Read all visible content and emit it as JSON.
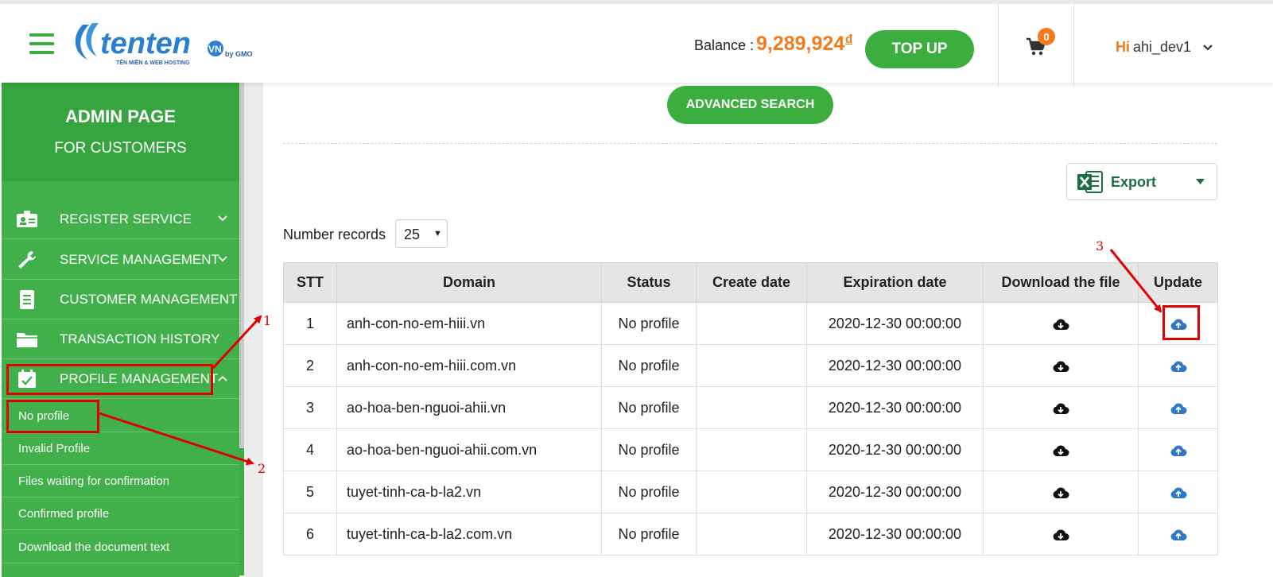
{
  "header": {
    "logo_text": "tenten",
    "logo_vn": "VN",
    "logo_gmo": "by GMO",
    "logo_tagline": "TÊN MIỀN & WEB HOSTING",
    "balance_label": "Balance :",
    "balance_amount": "9,289,924",
    "balance_currency": "đ",
    "topup_label": "TOP UP",
    "cart_count": "0",
    "greeting": "Hi",
    "username": "ahi_dev1"
  },
  "sidebar": {
    "title": "ADMIN PAGE",
    "subtitle": "FOR CUSTOMERS",
    "items": [
      {
        "label": "REGISTER SERVICE",
        "icon": "id-card-icon"
      },
      {
        "label": "SERVICE MANAGEMENT",
        "icon": "wrench-icon"
      },
      {
        "label": "CUSTOMER MANAGEMENT",
        "icon": "document-icon"
      },
      {
        "label": "TRANSACTION HISTORY",
        "icon": "folder-icon"
      },
      {
        "label": "PROFILE MANAGEMENT",
        "icon": "calendar-check-icon"
      }
    ],
    "sub_items": [
      {
        "label": "No profile"
      },
      {
        "label": "Invalid Profile"
      },
      {
        "label": "Files waiting for confirmation"
      },
      {
        "label": "Confirmed profile"
      },
      {
        "label": "Download the document text"
      }
    ]
  },
  "main": {
    "advanced_search_label": "ADVANCED SEARCH",
    "export_label": "Export",
    "number_records_label": "Number records",
    "number_records_value": "25",
    "columns": [
      "STT",
      "Domain",
      "Status",
      "Create date",
      "Expiration date",
      "Download the file",
      "Update"
    ],
    "rows": [
      {
        "stt": "1",
        "domain": "anh-con-no-em-hiii.vn",
        "status": "No profile",
        "create_date": "",
        "expiration_date": "2020-12-30 00:00:00"
      },
      {
        "stt": "2",
        "domain": "anh-con-no-em-hiii.com.vn",
        "status": "No profile",
        "create_date": "",
        "expiration_date": "2020-12-30 00:00:00"
      },
      {
        "stt": "3",
        "domain": "ao-hoa-ben-nguoi-ahii.vn",
        "status": "No profile",
        "create_date": "",
        "expiration_date": "2020-12-30 00:00:00"
      },
      {
        "stt": "4",
        "domain": "ao-hoa-ben-nguoi-ahii.com.vn",
        "status": "No profile",
        "create_date": "",
        "expiration_date": "2020-12-30 00:00:00"
      },
      {
        "stt": "5",
        "domain": "tuyet-tinh-ca-b-la2.vn",
        "status": "No profile",
        "create_date": "",
        "expiration_date": "2020-12-30 00:00:00"
      },
      {
        "stt": "6",
        "domain": "tuyet-tinh-ca-b-la2.com.vn",
        "status": "No profile",
        "create_date": "",
        "expiration_date": "2020-12-30 00:00:00"
      }
    ]
  },
  "annotations": {
    "label_1": "1",
    "label_2": "2",
    "label_3": "3"
  },
  "colors": {
    "brand_green": "#3cae3f",
    "sidebar_green": "#41b04a",
    "accent_orange": "#f37b1d",
    "annotation_red": "#e00000",
    "upload_blue": "#2f78c4"
  }
}
